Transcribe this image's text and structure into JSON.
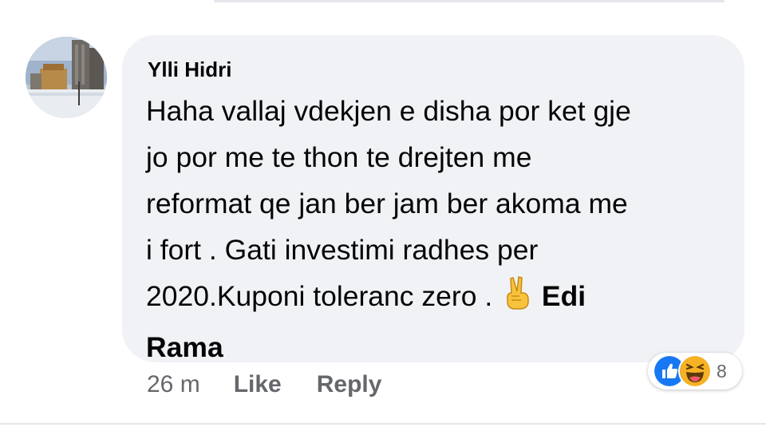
{
  "comment": {
    "author": "Ylli Hidri",
    "text_lines": [
      "Haha vallaj vdekjen e disha por ket gje",
      "jo por me te thon te drejten me",
      "reformat qe jan ber jam ber akoma me",
      "i fort . Gati investimi radhes per"
    ],
    "last_line_text": "2020.Kuponi toleranc zero . ",
    "tag_first": "Edi",
    "tag_second": "Rama"
  },
  "actions": {
    "time": "26 m",
    "like_label": "Like",
    "reply_label": "Reply"
  },
  "reactions": {
    "icons": [
      "like-icon",
      "haha-icon"
    ],
    "count": "8"
  },
  "colors": {
    "bubble_bg": "#f0f2f5",
    "secondary_text": "#65676b",
    "like_blue": "#1877f2",
    "haha_yellow": "#f7b125"
  }
}
